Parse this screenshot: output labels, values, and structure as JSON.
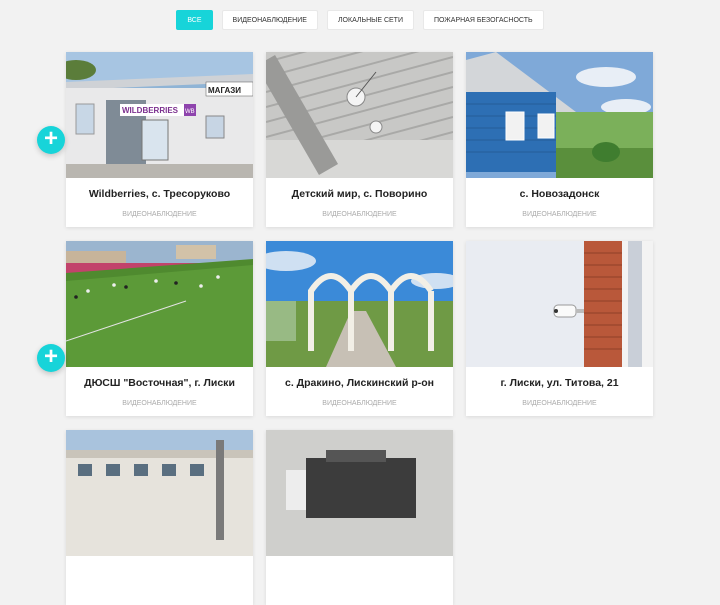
{
  "filters": {
    "all": "Все",
    "video": "Видеонаблюдение",
    "lan": "Локальные сети",
    "fire": "Пожарная безогасность"
  },
  "cards": [
    {
      "title": "Wildberries, с. Тресоруково",
      "category": "Видеонаблюдение"
    },
    {
      "title": "Детский мир, с. Поворино",
      "category": "Видеонаблюдение"
    },
    {
      "title": "с. Новозадонск",
      "category": "Видеонаблюдение"
    },
    {
      "title": "ДЮСШ \"Восточная\", г. Лиски",
      "category": "Видеонаблюдение"
    },
    {
      "title": "с. Дракино, Лискинский р-он",
      "category": "Видеонаблюдение"
    },
    {
      "title": "г. Лиски, ул. Титова, 21",
      "category": "Видеонаблюдение"
    }
  ],
  "plus_icon": "+",
  "photo1": {
    "sign_store": "МАГАЗИ",
    "sign_brand": "WILDBERRIES",
    "sign_wb": "WB"
  },
  "colors": {
    "accent": "#17d4d9"
  }
}
